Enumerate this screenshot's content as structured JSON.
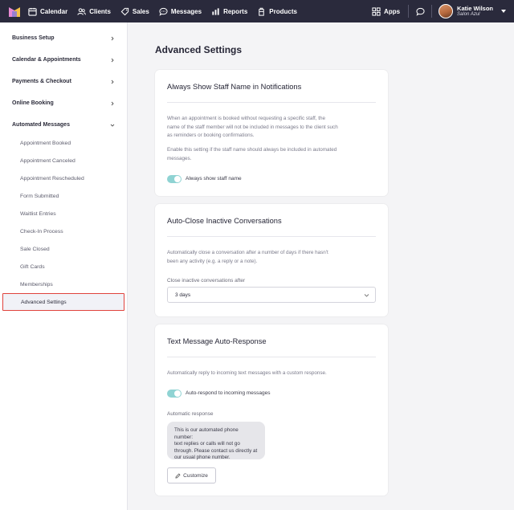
{
  "nav": {
    "items": [
      {
        "label": "Calendar",
        "icon": "calendar-icon"
      },
      {
        "label": "Clients",
        "icon": "clients-icon"
      },
      {
        "label": "Sales",
        "icon": "tag-icon"
      },
      {
        "label": "Messages",
        "icon": "chat-icon"
      },
      {
        "label": "Reports",
        "icon": "bar-chart-icon"
      },
      {
        "label": "Products",
        "icon": "box-icon"
      }
    ],
    "apps_label": "Apps",
    "user_name": "Katie Wilson",
    "user_salon": "Salon Azul",
    "colors": {
      "bar": "#2a2a3c",
      "logo_left": "#e98ad3",
      "logo_right": "#f5c24b"
    }
  },
  "sidebar": {
    "sections": [
      {
        "label": "Business Setup"
      },
      {
        "label": "Calendar & Appointments"
      },
      {
        "label": "Payments & Checkout"
      },
      {
        "label": "Online Booking"
      },
      {
        "label": "Automated Messages"
      }
    ],
    "sub_items": [
      {
        "label": "Appointment Booked"
      },
      {
        "label": "Appointment Canceled"
      },
      {
        "label": "Appointment Rescheduled"
      },
      {
        "label": "Form Submitted"
      },
      {
        "label": "Waitlist Entries"
      },
      {
        "label": "Check-In Process"
      },
      {
        "label": "Sale Closed"
      },
      {
        "label": "Gift Cards"
      },
      {
        "label": "Memberships"
      }
    ],
    "active_item": "Advanced Settings",
    "highlight_color": "#e0433d"
  },
  "main": {
    "title": "Advanced Settings",
    "card1": {
      "title": "Always Show Staff Name in Notifications",
      "text1_lines": [
        "When an appointment is booked without requesting a specific staff, the",
        "name of the staff member will not be included in messages to the client such",
        "as reminders or booking confirmations."
      ],
      "text2_lines": [
        "Enable this setting if the staff name should always be included in automated",
        "messages."
      ],
      "toggle_label": "Always show staff name",
      "toggle_on": true
    },
    "card2": {
      "title": "Auto-Close Inactive Conversations",
      "text_lines": [
        "Automatically close a conversation after a number of days if there hasn't",
        "been any activity (e.g. a reply or a note)."
      ],
      "field_label": "Close inactive conversations after",
      "select_value": "3 days"
    },
    "card3": {
      "title": "Text Message Auto-Response",
      "text": "Automatically reply to incoming text messages with a custom response.",
      "toggle_label": "Auto-respond to incoming messages",
      "toggle_on": true,
      "field_label": "Automatic response",
      "response_lines": [
        "This is our automated phone number:",
        "text replies or calls will not go",
        "through. Please contact us directly at",
        "our usual phone number."
      ],
      "customize_label": "Customize"
    },
    "toggle_color": "#8fd3d3"
  }
}
